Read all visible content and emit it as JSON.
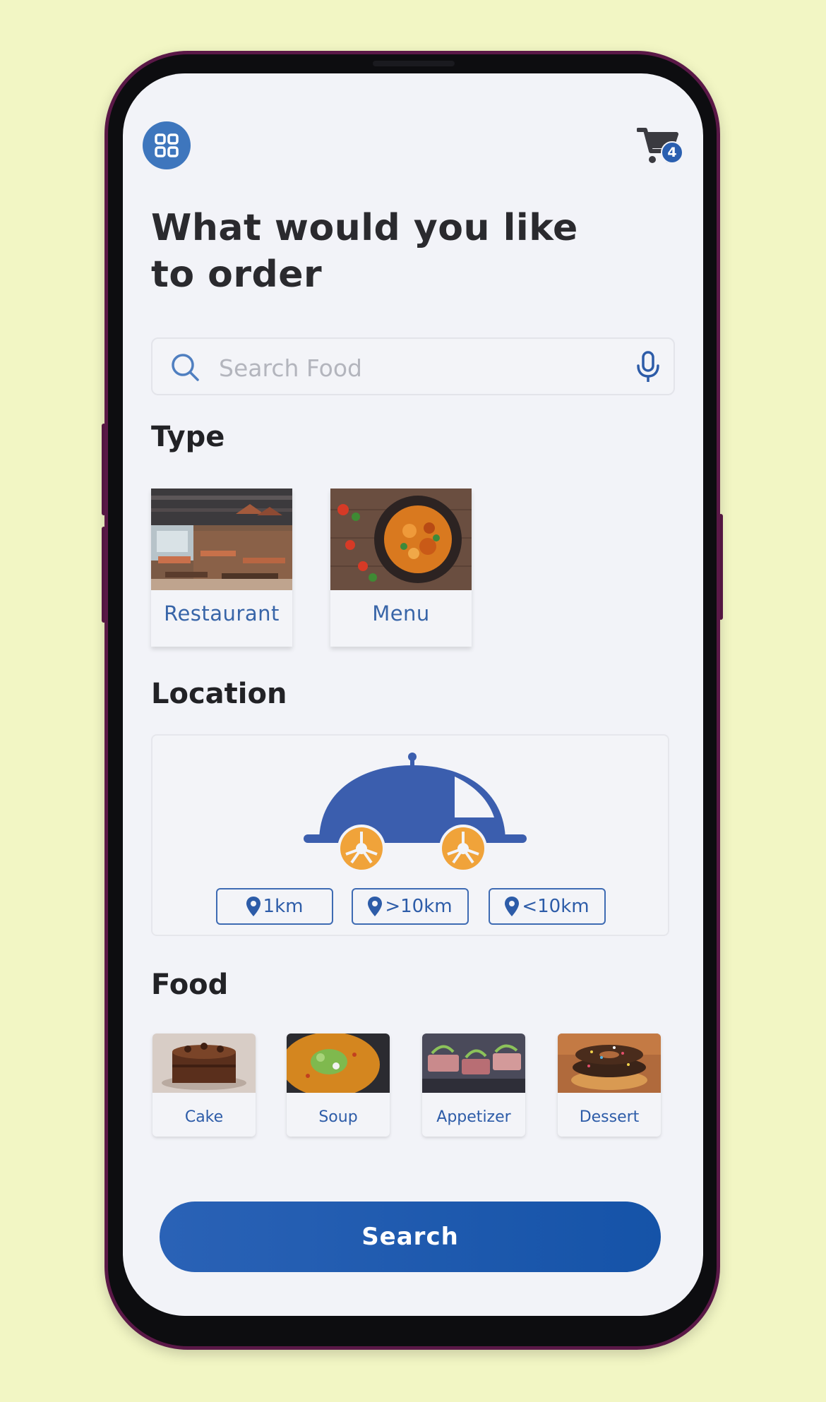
{
  "header": {
    "menu_icon": "grid-icon",
    "cart_icon": "cart-icon",
    "cart_count": "4"
  },
  "title": {
    "line1": "What would you like",
    "line2": "to order"
  },
  "search": {
    "placeholder": "Search Food",
    "value": "",
    "search_icon": "search-icon",
    "mic_icon": "microphone-icon"
  },
  "type": {
    "heading": "Type",
    "items": [
      {
        "label": "Restaurant"
      },
      {
        "label": "Menu"
      }
    ]
  },
  "location": {
    "heading": "Location",
    "options": [
      {
        "label": "1km"
      },
      {
        "label": ">10km"
      },
      {
        "label": "<10km"
      }
    ]
  },
  "food": {
    "heading": "Food",
    "items": [
      {
        "label": "Cake"
      },
      {
        "label": "Soup"
      },
      {
        "label": "Appetizer"
      },
      {
        "label": "Dessert"
      }
    ]
  },
  "action": {
    "search_label": "Search"
  },
  "colors": {
    "background": "#f2f6c4",
    "accent": "#2a62b6",
    "wheel": "#f0a33a",
    "text_dark": "#2a2a2e"
  }
}
